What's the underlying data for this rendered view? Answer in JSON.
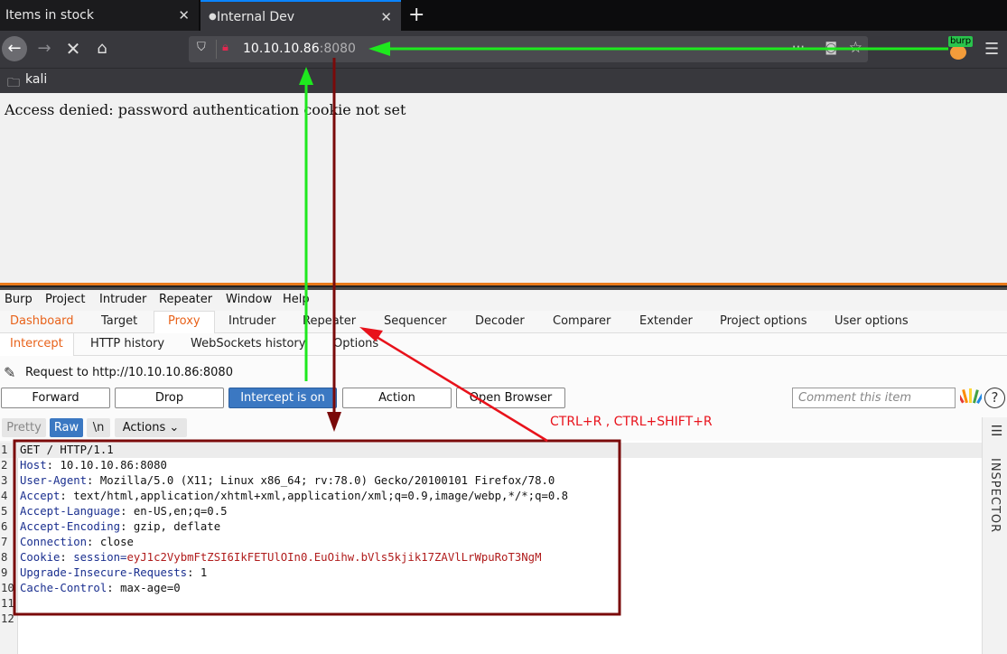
{
  "browser": {
    "tabs": [
      {
        "title": "Items in stock",
        "close": "✕"
      },
      {
        "title": "Internal Dev",
        "close": "✕"
      }
    ],
    "new_tab": "+",
    "url_host": "10.10.10.86",
    "url_port": ":8080",
    "url_more": "···",
    "bookmark": "kali",
    "extension_badge": "burp"
  },
  "page": {
    "message": "Access denied: password authentication cookie not set"
  },
  "burp": {
    "menu": [
      "Burp",
      "Project",
      "Intruder",
      "Repeater",
      "Window",
      "Help"
    ],
    "tabs": [
      "Dashboard",
      "Target",
      "Proxy",
      "Intruder",
      "Repeater",
      "Sequencer",
      "Decoder",
      "Comparer",
      "Extender",
      "Project options",
      "User options"
    ],
    "subtabs": [
      "Intercept",
      "HTTP history",
      "WebSockets history",
      "Options"
    ],
    "request_to": "Request to http://10.10.10.86:8080",
    "buttons": {
      "forward": "Forward",
      "drop": "Drop",
      "intercept": "Intercept is on",
      "action": "Action",
      "open_browser": "Open Browser"
    },
    "comment_placeholder": "Comment this item",
    "view": {
      "pretty": "Pretty",
      "raw": "Raw",
      "newline": "\\n",
      "actions": "Actions ⌄"
    },
    "inspector": "INSPECTOR",
    "request_lines": [
      {
        "num": "1",
        "key": "",
        "sep": "",
        "val": "GET / HTTP/1.1"
      },
      {
        "num": "2",
        "key": "Host",
        "sep": ": ",
        "val": "10.10.10.86:8080"
      },
      {
        "num": "3",
        "key": "User-Agent",
        "sep": ": ",
        "val": "Mozilla/5.0 (X11; Linux x86_64; rv:78.0) Gecko/20100101 Firefox/78.0"
      },
      {
        "num": "4",
        "key": "Accept",
        "sep": ": ",
        "val": "text/html,application/xhtml+xml,application/xml;q=0.9,image/webp,*/*;q=0.8"
      },
      {
        "num": "5",
        "key": "Accept-Language",
        "sep": ": ",
        "val": "en-US,en;q=0.5"
      },
      {
        "num": "6",
        "key": "Accept-Encoding",
        "sep": ": ",
        "val": "gzip, deflate"
      },
      {
        "num": "7",
        "key": "Connection",
        "sep": ": ",
        "val": "close"
      },
      {
        "num": "8",
        "key": "Cookie",
        "sep": ": ",
        "val": "session=",
        "cookie": "eyJ1c2VybmFtZSI6IkFETUlOIn0.EuOihw.bVls5kjik17ZAVlLrWpuRoT3NgM"
      },
      {
        "num": "9",
        "key": "Upgrade-Insecure-Requests",
        "sep": ": ",
        "val": "1"
      },
      {
        "num": "10",
        "key": "Cache-Control",
        "sep": ": ",
        "val": "max-age=0"
      },
      {
        "num": "11",
        "key": "",
        "sep": "",
        "val": ""
      },
      {
        "num": "12",
        "key": "",
        "sep": "",
        "val": ""
      }
    ]
  },
  "annotation": {
    "hint": "CTRL+R , CTRL+SHIFT+R",
    "colors": {
      "green": "#1ee81e",
      "darkred": "#7a0a0a",
      "red": "#e8121b"
    }
  }
}
